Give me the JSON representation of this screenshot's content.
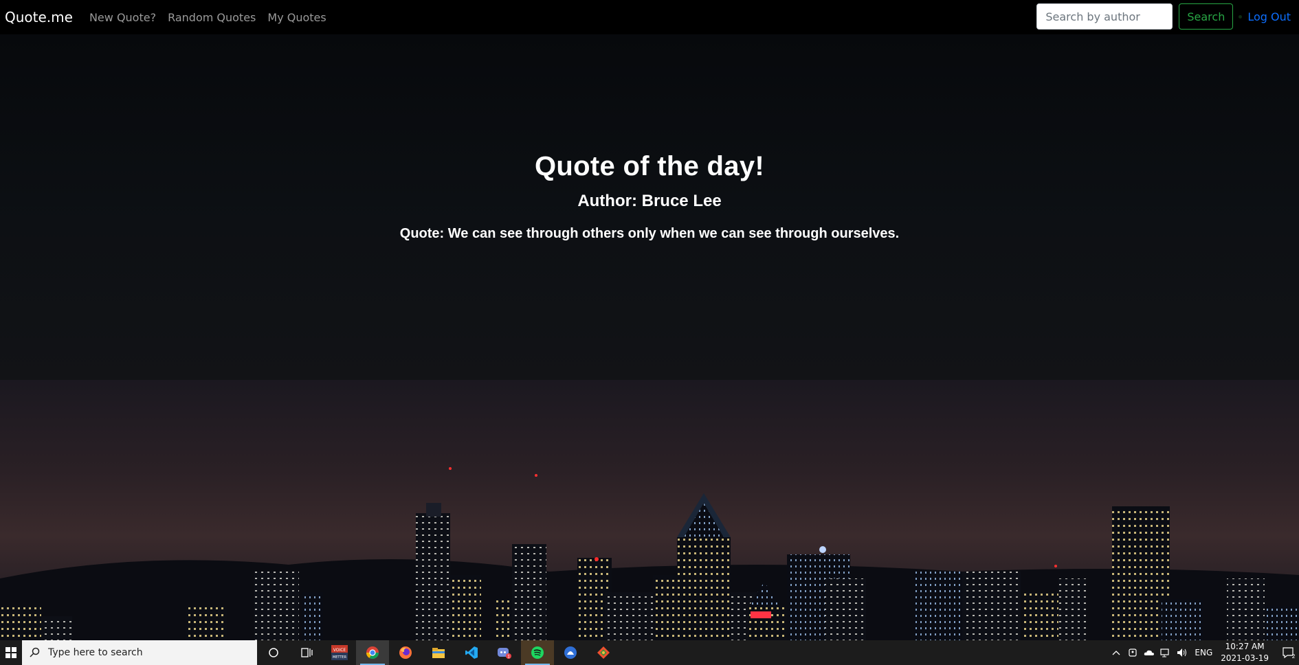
{
  "navbar": {
    "brand": "Quote.me",
    "links": [
      "New Quote?",
      "Random Quotes",
      "My Quotes"
    ],
    "search_placeholder": "Search by author",
    "search_button": "Search",
    "logout": "Log Out"
  },
  "quote": {
    "title": "Quote of the day!",
    "author_line": "Author: Bruce Lee",
    "quote_line": "Quote: We can see through others only when we can see through ourselves."
  },
  "taskbar": {
    "search_placeholder": "Type here to search",
    "apps": [
      "cortana-icon",
      "task-view-icon",
      "voicemeeter-icon",
      "chrome-icon",
      "firefox-icon",
      "file-explorer-icon",
      "vscode-icon",
      "discord-icon",
      "spotify-icon",
      "app-icon",
      "git-icon"
    ],
    "language": "ENG",
    "time": "10:27 AM",
    "date": "2021-03-19",
    "notification_count": "2"
  },
  "colors": {
    "success": "#28a745",
    "link_blue": "#0d6efd",
    "nav_muted": "#9a9a9a"
  }
}
